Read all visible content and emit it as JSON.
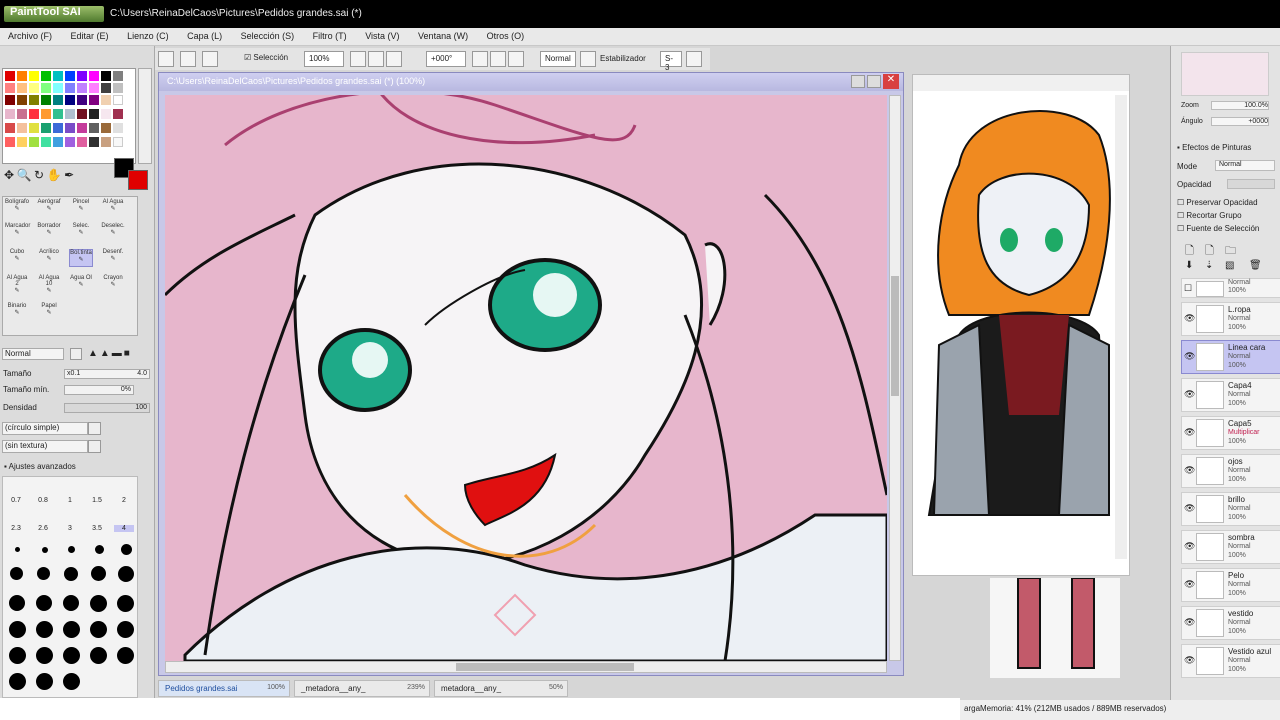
{
  "window": {
    "app": "PaintTool SAI",
    "title": "C:\\Users\\ReinaDelCaos\\Pictures\\Pedidos grandes.sai (*)"
  },
  "menu": [
    "Archivo (F)",
    "Editar (E)",
    "Lienzo (C)",
    "Capa (L)",
    "Selección (S)",
    "Filtro (T)",
    "Vista (V)",
    "Ventana (W)",
    "Otros (O)"
  ],
  "toolbar": {
    "selection_label": "Selección",
    "zoom": "100%",
    "angle": "+000°",
    "mode": "Normal",
    "stabilizer_label": "Estabilizador",
    "stabilizer_value": "S-3"
  },
  "tools": {
    "row1": [
      "Bolígrafo",
      "Aerógraf",
      "Pincel",
      "Al Agua"
    ],
    "row2": [
      "Marcador",
      "Borrador",
      "Selec.",
      "Deselec."
    ],
    "row3": [
      "Cubo",
      "Acrílico",
      "Bol.tinta",
      "Desenf."
    ],
    "row4": [
      "Al Agua 2",
      "Al Agua 10",
      "Agua Ol",
      "Crayon"
    ],
    "row5": [
      "Binario",
      "Papel"
    ]
  },
  "brush": {
    "blend": "Normal",
    "size_label": "Tamaño",
    "size_mult": "x0.1",
    "size_value": "4.0",
    "min_label": "Tamaño mín.",
    "min_value": "0%",
    "density_label": "Densidad",
    "density_value": "100",
    "shape": "(círculo simple)",
    "texture": "(sin textura)",
    "advanced": "Ajustes avanzados"
  },
  "brush_sizes": [
    "0.7",
    "0.8",
    "1",
    "1.5",
    "2",
    "2.3",
    "2.6",
    "3",
    "3.5",
    "4"
  ],
  "canvas": {
    "title": "C:\\Users\\ReinaDelCaos\\Pictures\\Pedidos grandes.sai (*) (100%)"
  },
  "navigator": {
    "zoom_label": "Zoom",
    "zoom_value": "100.0%",
    "angle_label": "Ángulo",
    "angle_value": "+0000"
  },
  "effects": {
    "header": "Efectos de Pinturas",
    "mode_label": "Mode",
    "mode_value": "Normal",
    "opacity_label": "Opacidad",
    "preserve": "Preservar Opacidad",
    "clip": "Recortar Grupo",
    "source": "Fuente de Selección"
  },
  "layers": [
    {
      "name": "",
      "mode": "Normal",
      "opacity": "100%",
      "selected": false
    },
    {
      "name": "L.ropa",
      "mode": "Normal",
      "opacity": "100%",
      "selected": false
    },
    {
      "name": "Linea cara",
      "mode": "Normal",
      "opacity": "100%",
      "selected": true
    },
    {
      "name": "Capa4",
      "mode": "Normal",
      "opacity": "100%",
      "selected": false
    },
    {
      "name": "Capa5",
      "mode": "Multiplicar",
      "opacity": "100%",
      "selected": false
    },
    {
      "name": "ojos",
      "mode": "Normal",
      "opacity": "100%",
      "selected": false
    },
    {
      "name": "brillo",
      "mode": "Normal",
      "opacity": "100%",
      "selected": false
    },
    {
      "name": "sombra",
      "mode": "Normal",
      "opacity": "100%",
      "selected": false
    },
    {
      "name": "Pelo",
      "mode": "Normal",
      "opacity": "100%",
      "selected": false
    },
    {
      "name": "vestido",
      "mode": "Normal",
      "opacity": "100%",
      "selected": false
    },
    {
      "name": "Vestido azul",
      "mode": "Normal",
      "opacity": "100%",
      "selected": false
    }
  ],
  "tabs": [
    {
      "name": "Pedidos grandes.sai",
      "zoom": "100%"
    },
    {
      "name": "_metadora__any_",
      "zoom": "239%"
    },
    {
      "name": "metadora__any_",
      "zoom": "50%"
    }
  ],
  "status": "argaMemoria: 41% (212MB usados / 889MB reservados)",
  "colors": {
    "canvas_frame": "#c8c8e8",
    "selected_layer": "#c5c5f2",
    "art_pink": "#e7b6cc"
  }
}
